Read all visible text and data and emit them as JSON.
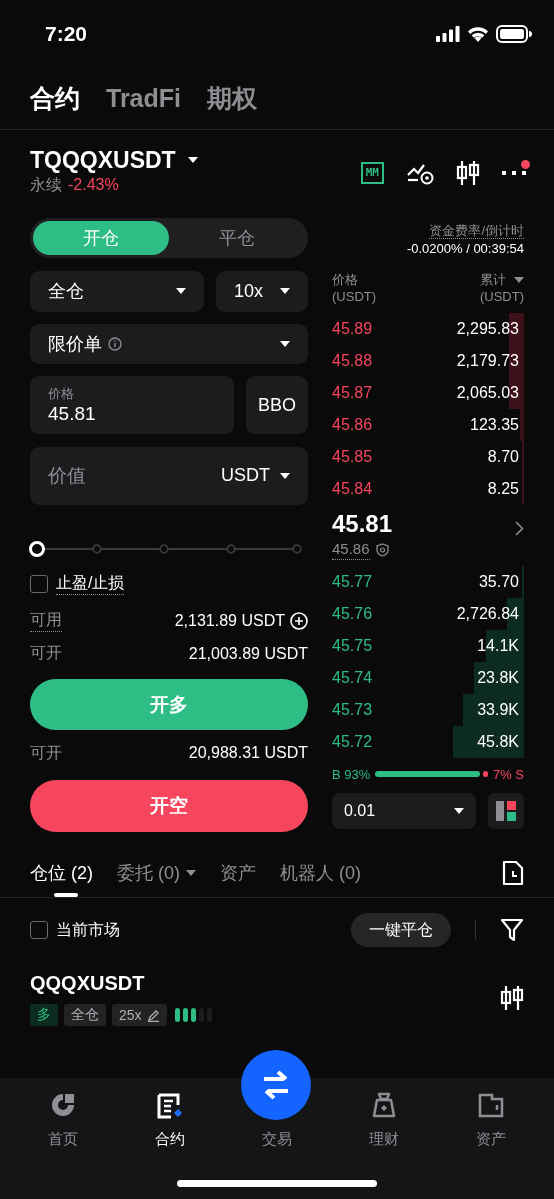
{
  "status_bar": {
    "time": "7:20"
  },
  "top_tabs": [
    {
      "label": "合约",
      "selected": true
    },
    {
      "label": "TradFi",
      "selected": false
    },
    {
      "label": "期权",
      "selected": false
    }
  ],
  "instrument": {
    "symbol": "TQQQXUSDT",
    "type": "永续",
    "change": "-2.43%",
    "mm_badge": "MM",
    "alert_dot": true
  },
  "order_form": {
    "mode_tabs": [
      {
        "label": "开仓",
        "selected": true
      },
      {
        "label": "平仓",
        "selected": false
      }
    ],
    "margin_mode": "全仓",
    "leverage": "10x",
    "order_type": "限价单",
    "price_field": {
      "label": "价格",
      "value": "45.81"
    },
    "bbo_button": "BBO",
    "value_field": {
      "placeholder": "价值",
      "unit": "USDT"
    },
    "slider": {
      "level": 0
    },
    "tpsl": {
      "label": "止盈/止损",
      "checked": false
    },
    "available": {
      "label": "可用",
      "value": "2,131.89 USDT"
    },
    "max_long": {
      "label": "可开",
      "value": "21,003.89 USDT"
    },
    "long_button": "开多",
    "max_short": {
      "label": "可开",
      "value": "20,988.31 USDT"
    },
    "short_button": "开空"
  },
  "order_book": {
    "funding_label": "资金费率/倒计时",
    "funding_value": "-0.0200% / 00:39:54",
    "price_header": "价格",
    "price_unit": "(USDT)",
    "total_header": "累计",
    "total_unit": "(USDT)",
    "asks": [
      {
        "price": "45.89",
        "total": "2,295.83",
        "level": 0.08
      },
      {
        "price": "45.88",
        "total": "2,179.73",
        "level": 0.08
      },
      {
        "price": "45.87",
        "total": "2,065.03",
        "level": 0.08
      },
      {
        "price": "45.86",
        "total": "123.35",
        "level": 0.02
      },
      {
        "price": "45.85",
        "total": "8.70",
        "level": 0.01
      },
      {
        "price": "45.84",
        "total": "8.25",
        "level": 0.01
      }
    ],
    "last_price": "45.81",
    "mark_price": "45.86",
    "bids": [
      {
        "price": "45.77",
        "total": "35.70",
        "level": 0.01
      },
      {
        "price": "45.76",
        "total": "2,726.84",
        "level": 0.09
      },
      {
        "price": "45.75",
        "total": "14.1K",
        "level": 0.2
      },
      {
        "price": "45.74",
        "total": "23.8K",
        "level": 0.26
      },
      {
        "price": "45.73",
        "total": "33.9K",
        "level": 0.32
      },
      {
        "price": "45.72",
        "total": "45.8K",
        "level": 0.37
      }
    ],
    "buy_ratio": {
      "label": "B 93%",
      "level": 0.93
    },
    "sell_label": "7% S",
    "tick_size": "0.01"
  },
  "position_tabs": [
    {
      "label": "仓位 (2)",
      "selected": true,
      "dropdown": false
    },
    {
      "label": "委托 (0)",
      "selected": false,
      "dropdown": true
    },
    {
      "label": "资产",
      "selected": false,
      "dropdown": false
    },
    {
      "label": "机器人 (0)",
      "selected": false,
      "dropdown": false
    }
  ],
  "positions_toolbar": {
    "current_market": {
      "label": "当前市场",
      "checked": false
    },
    "close_all_button": "一键平仓"
  },
  "position": {
    "symbol": "QQQXUSDT",
    "side": "多",
    "margin_mode": "全仓",
    "leverage": "25x",
    "adl": {
      "level": 0.6
    }
  },
  "bottom_nav": [
    {
      "label": "首页",
      "selected": false,
      "kind": "tab"
    },
    {
      "label": "合约",
      "selected": true,
      "kind": "tab"
    },
    {
      "label": "交易",
      "selected": false,
      "kind": "fab"
    },
    {
      "label": "理财",
      "selected": false,
      "kind": "tab"
    },
    {
      "label": "资产",
      "selected": false,
      "kind": "tab"
    }
  ]
}
